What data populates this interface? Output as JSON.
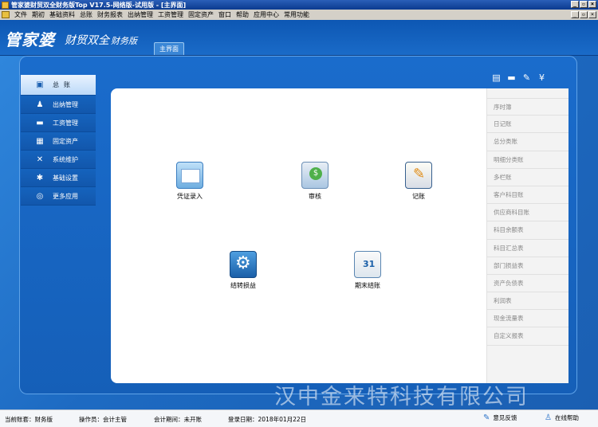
{
  "window": {
    "title": "管家婆财贸双全财务版Top V17.5-网络版-试用版 - [主界面]"
  },
  "menu": [
    "文件",
    "期初",
    "基础资料",
    "总账",
    "财务报表",
    "出纳管理",
    "工资管理",
    "固定资产",
    "窗口",
    "帮助",
    "应用中心",
    "常用功能"
  ],
  "header": {
    "logo": "管家婆",
    "product": "财贸双全",
    "edition": "财务版",
    "tab": "主界面"
  },
  "nav": [
    {
      "label": "总账",
      "icon": "ledger-icon",
      "glyph": "▣"
    },
    {
      "label": "出纳管理",
      "icon": "cashier-icon",
      "glyph": "♟"
    },
    {
      "label": "工资管理",
      "icon": "salary-icon",
      "glyph": "▬"
    },
    {
      "label": "固定资产",
      "icon": "assets-icon",
      "glyph": "▦"
    },
    {
      "label": "系统维护",
      "icon": "tools-icon",
      "glyph": "✕"
    },
    {
      "label": "基础设置",
      "icon": "settings-icon",
      "glyph": "✱"
    },
    {
      "label": "更多应用",
      "icon": "more-apps-icon",
      "glyph": "◎"
    }
  ],
  "functions": {
    "voucher": "凭证录入",
    "audit": "审核",
    "post": "记账",
    "carry": "结转损益",
    "close": "期末结账"
  },
  "reports": [
    "序时簿",
    "日记账",
    "总分类账",
    "明细分类账",
    "多栏账",
    "客户科目账",
    "供应商科目账",
    "科目余额表",
    "科目汇总表",
    "部门损益表",
    "资产负债表",
    "利润表",
    "现金流量表",
    "自定义报表"
  ],
  "watermark": "汉中金来特科技有限公司",
  "status": {
    "account": "当前账套：财务版",
    "operator": "操作员：会计主管",
    "period": "会计期间：未开账",
    "login_date": "登录日期：2018年01月22日",
    "feedback": "意见反馈",
    "help": "在线帮助"
  },
  "colors": {
    "accent": "#1a6bc8",
    "panel": "#ffffff",
    "list_bg": "#f3f3f3"
  }
}
